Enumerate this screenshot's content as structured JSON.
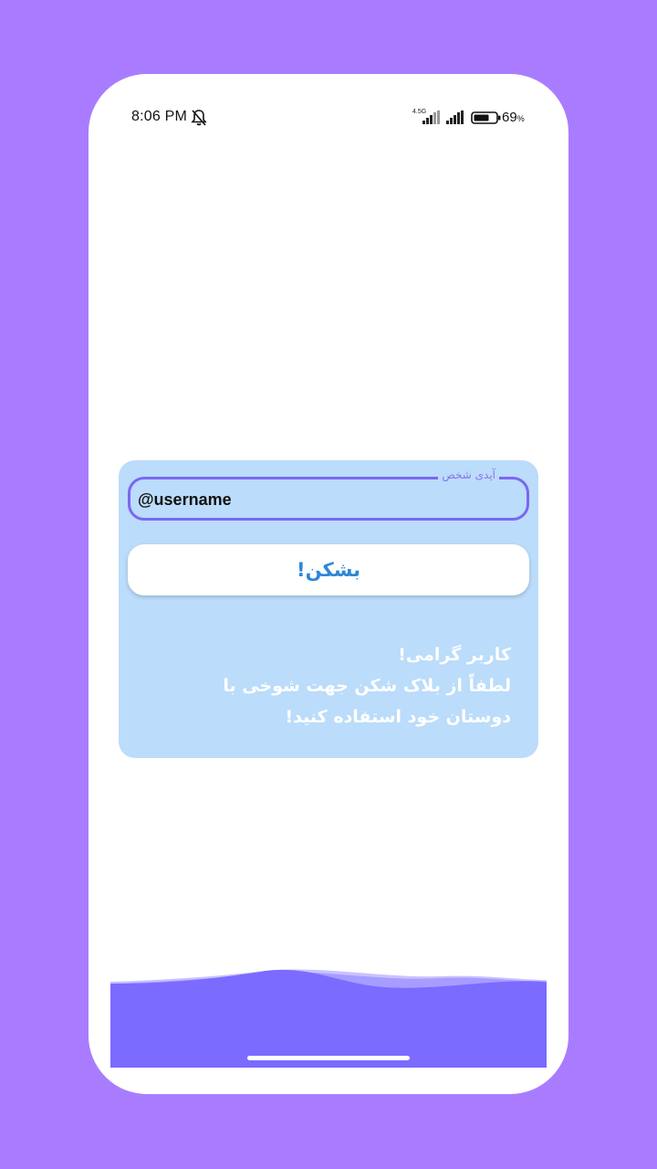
{
  "status_bar": {
    "time": "8:06 PM",
    "network_type": "4.5G",
    "battery": "69",
    "battery_unit": "%",
    "icons": [
      "bell-off-icon",
      "signal-icon",
      "signal-icon",
      "battery-icon"
    ]
  },
  "form": {
    "input_label": "آیدی شخص",
    "input_value": "@username",
    "button_label": "بشکن!"
  },
  "message": {
    "line1": "کاربر گرامی!",
    "line2": "لطفاً از بلاک شکن جهت شوخی با",
    "line3": "دوستان خود استفاده کنید!"
  },
  "colors": {
    "background": "#a97cff",
    "card": "#bbdcfa",
    "accent": "#7a67f2",
    "button_text": "#2f86d6",
    "wave": "#7b6bff"
  }
}
